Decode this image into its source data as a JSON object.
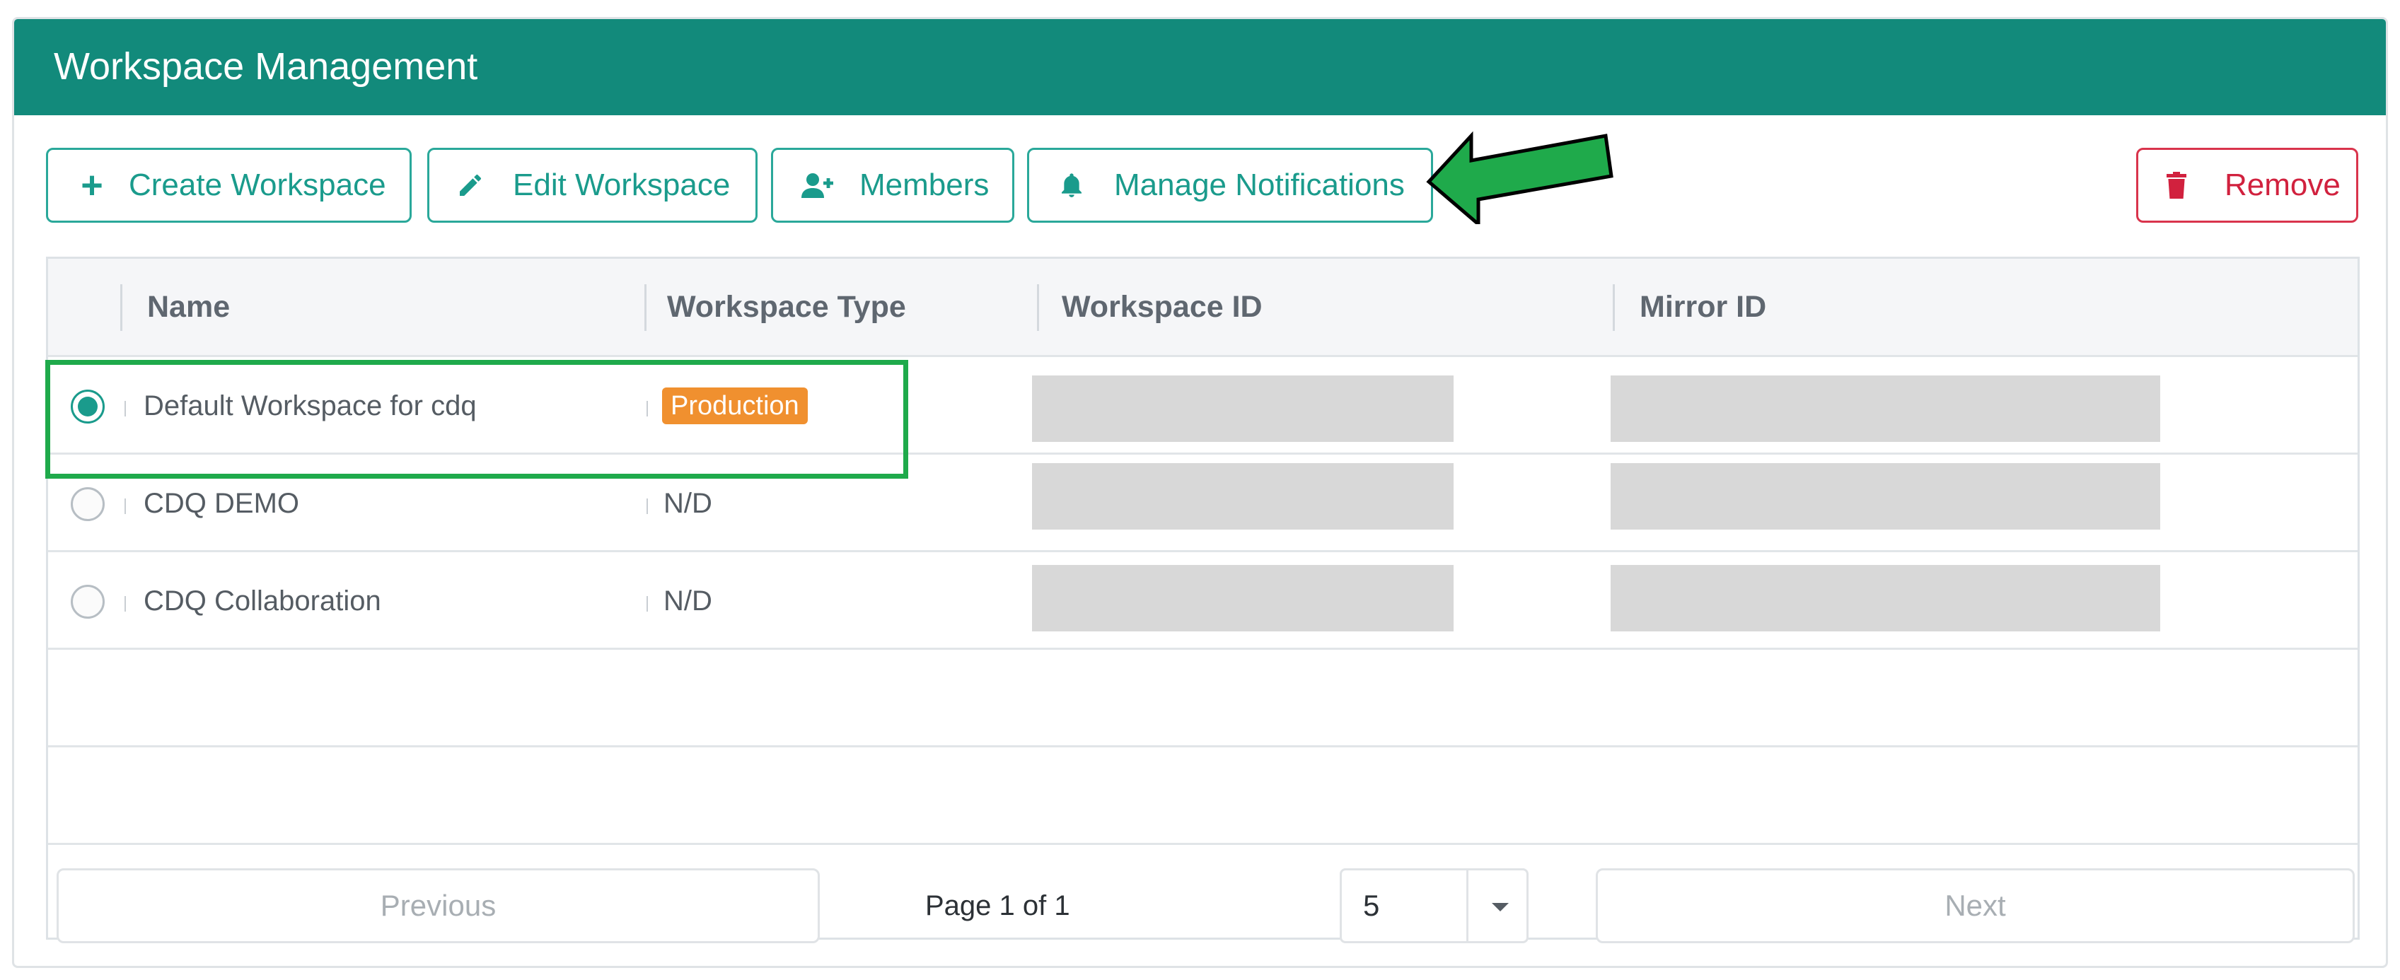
{
  "panel": {
    "title": "Workspace Management"
  },
  "toolbar": {
    "create_label": "Create Workspace",
    "edit_label": "Edit Workspace",
    "members_label": "Members",
    "notifications_label": "Manage Notifications",
    "remove_label": "Remove"
  },
  "table": {
    "columns": [
      "Name",
      "Workspace Type",
      "Workspace ID",
      "Mirror ID"
    ],
    "rows": [
      {
        "name": "Default Workspace for cdq",
        "type": "Production",
        "selected": true
      },
      {
        "name": "CDQ DEMO",
        "type": "N/D",
        "selected": false
      },
      {
        "name": "CDQ Collaboration",
        "type": "N/D",
        "selected": false
      }
    ]
  },
  "pagination": {
    "previous_label": "Previous",
    "next_label": "Next",
    "page_info": "Page 1 of 1",
    "page_size": "5"
  },
  "colors": {
    "header_bg": "#128a7b",
    "accent": "#1a9b8c",
    "remove": "#d1213e",
    "badge": "#f0902f",
    "annotation": "#1faa4b"
  }
}
